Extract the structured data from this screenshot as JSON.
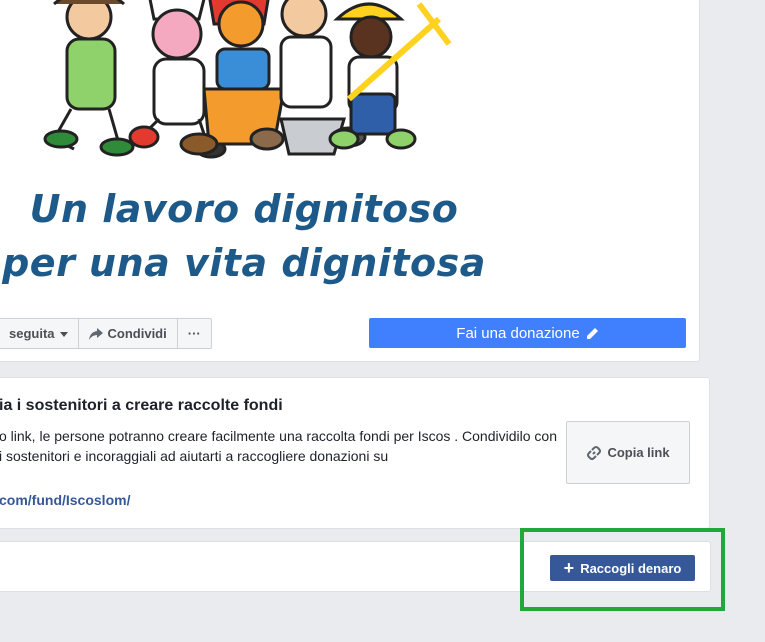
{
  "banner": {
    "slogan_line1": "Un lavoro dignitoso",
    "slogan_line2": "per una vita dignitosa"
  },
  "actions": {
    "follow_label": "seguita",
    "share_label": "Condividi",
    "more_label": "···",
    "donate_label": "Fai una donazione"
  },
  "fundraiser": {
    "title": "ia i sostenitori a creare raccolte fondi",
    "description": "o link, le persone potranno creare facilmente una raccolta fondi per Iscos . Condividilo con i sostenitori e incoraggiali ad aiutarti a raccogliere donazioni su",
    "link": "com/fund/Iscoslom/",
    "copy_label": "Copia link"
  },
  "footer": {
    "raise_label": "Raccogli denaro",
    "raise_icon": "plus-icon"
  },
  "colors": {
    "donate": "#4080ff",
    "raise": "#365899",
    "highlight": "#22a83a",
    "slogan": "#1d5a8a"
  }
}
